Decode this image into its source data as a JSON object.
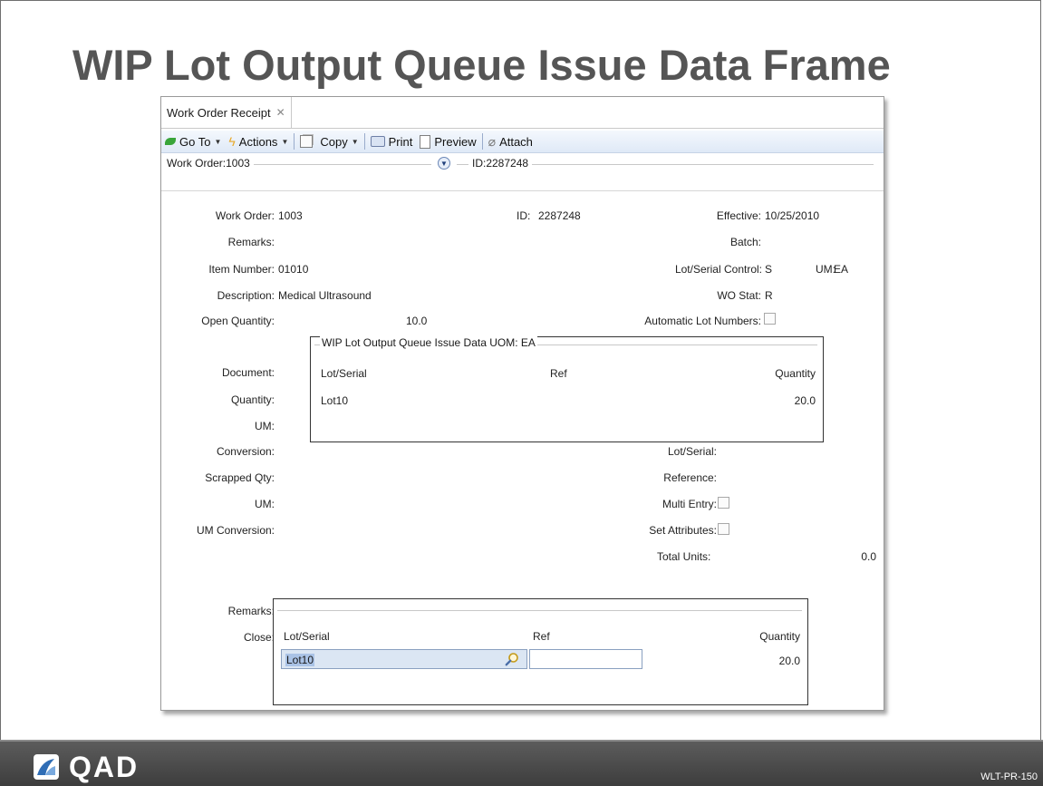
{
  "slide": {
    "title": "WIP Lot Output Queue Issue Data Frame",
    "footer_code": "WLT-PR-150",
    "logo_text": "QAD"
  },
  "tab": {
    "label": "Work Order Receipt",
    "close": "✕"
  },
  "toolbar": {
    "goto": "Go To",
    "actions": "Actions",
    "copy": "Copy",
    "print": "Print",
    "preview": "Preview",
    "attach": "Attach"
  },
  "breadcrumb": {
    "work_order": "Work Order:1003",
    "id": "ID:2287248"
  },
  "form": {
    "work_order_label": "Work Order:",
    "work_order_value": "1003",
    "id_label": "ID:",
    "id_value": "2287248",
    "effective_label": "Effective:",
    "effective_value": "10/25/2010",
    "remarks_label": "Remarks:",
    "batch_label": "Batch:",
    "item_number_label": "Item Number:",
    "item_number_value": "01010",
    "lot_serial_control_label": "Lot/Serial Control:",
    "lot_serial_control_value": "S",
    "um_label": "UM:",
    "um_value": "EA",
    "description_label": "Description:",
    "description_value": "Medical Ultrasound",
    "wo_stat_label": "WO Stat:",
    "wo_stat_value": "R",
    "open_qty_label": "Open Quantity:",
    "open_qty_value": "10.0",
    "auto_lot_label": "Automatic Lot Numbers:",
    "document_label": "Document:",
    "quantity_label": "Quantity:",
    "um2_label": "UM:",
    "conversion_label": "Conversion:",
    "lot_serial_label": "Lot/Serial:",
    "scrapped_qty_label": "Scrapped Qty:",
    "reference_label": "Reference:",
    "um3_label": "UM:",
    "multi_entry_label": "Multi Entry:",
    "um_conversion_label": "UM Conversion:",
    "set_attributes_label": "Set Attributes:",
    "total_units_label": "Total Units:",
    "total_units_value": "0.0",
    "remarks2_label": "Remarks:",
    "close_label": "Close:"
  },
  "wip_frame": {
    "title": "WIP Lot Output Queue Issue Data  UOM: EA",
    "columns": [
      "Lot/Serial",
      "Ref",
      "Quantity"
    ],
    "rows": [
      {
        "lot": "Lot10",
        "ref": "",
        "qty": "20.0"
      }
    ]
  },
  "edit_frame": {
    "columns": [
      "Lot/Serial",
      "Ref",
      "Quantity"
    ],
    "lot_value": "Lot10",
    "ref_value": "",
    "qty_value": "20.0"
  }
}
